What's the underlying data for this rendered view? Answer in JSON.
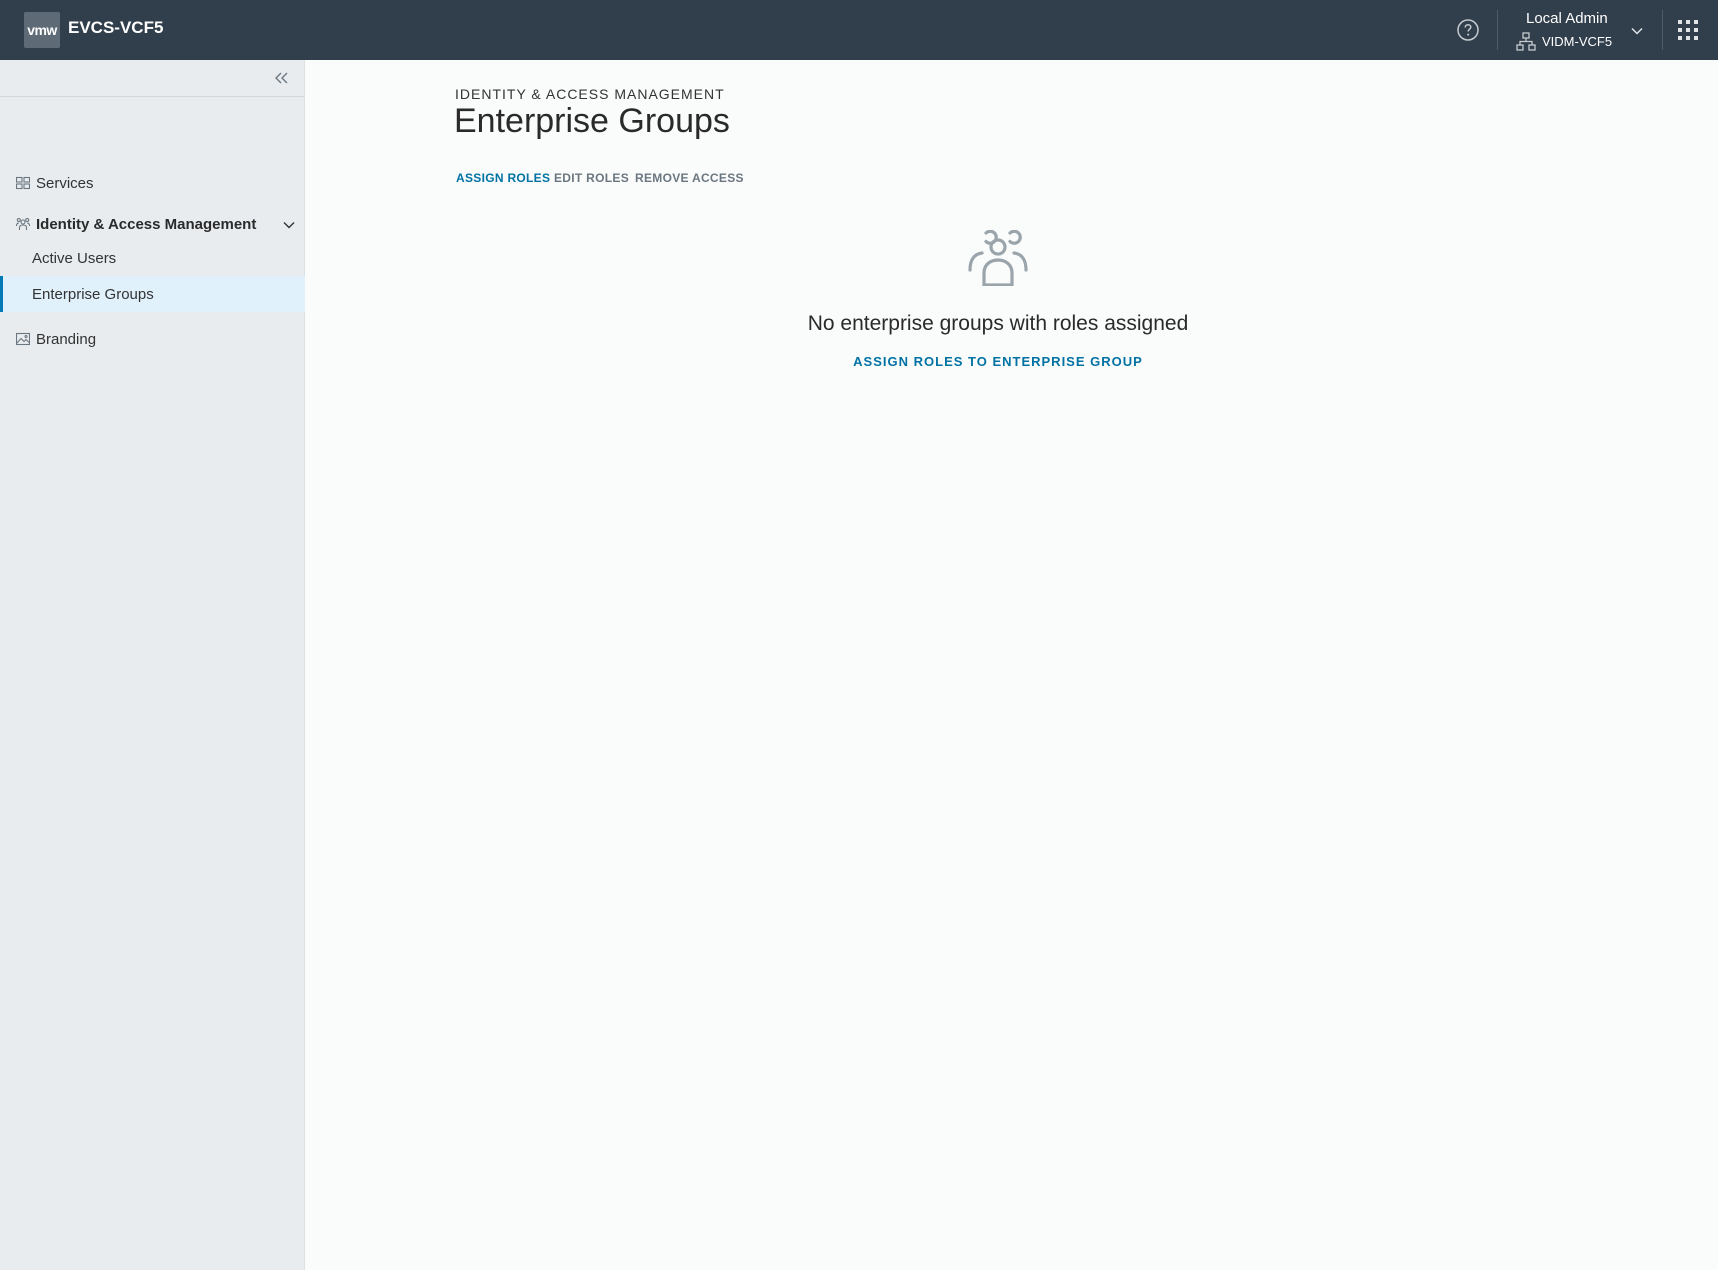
{
  "header": {
    "logo_text": "vmw",
    "app_title": "EVCS-VCF5",
    "user_name": "Local Admin",
    "tenant_name": "VIDM-VCF5"
  },
  "sidebar": {
    "items": [
      {
        "label": "Services",
        "icon": "services-grid-icon"
      },
      {
        "label": "Identity & Access Management",
        "icon": "users-group-icon",
        "expanded": true,
        "children": [
          {
            "label": "Active Users",
            "active": false
          },
          {
            "label": "Enterprise Groups",
            "active": true
          }
        ]
      },
      {
        "label": "Branding",
        "icon": "image-icon"
      }
    ]
  },
  "main": {
    "breadcrumb": "IDENTITY & ACCESS MANAGEMENT",
    "title": "Enterprise Groups",
    "actions": {
      "assign": "ASSIGN ROLES",
      "edit": "EDIT ROLES",
      "remove": "REMOVE ACCESS"
    },
    "empty_state": {
      "message": "No enterprise groups with roles assigned",
      "link": "ASSIGN ROLES TO ENTERPRISE GROUP"
    }
  },
  "colors": {
    "header_bg": "#313e4b",
    "sidebar_bg": "#e8ecef",
    "accent": "#0072a3",
    "active_bg": "#e1f1fb"
  }
}
